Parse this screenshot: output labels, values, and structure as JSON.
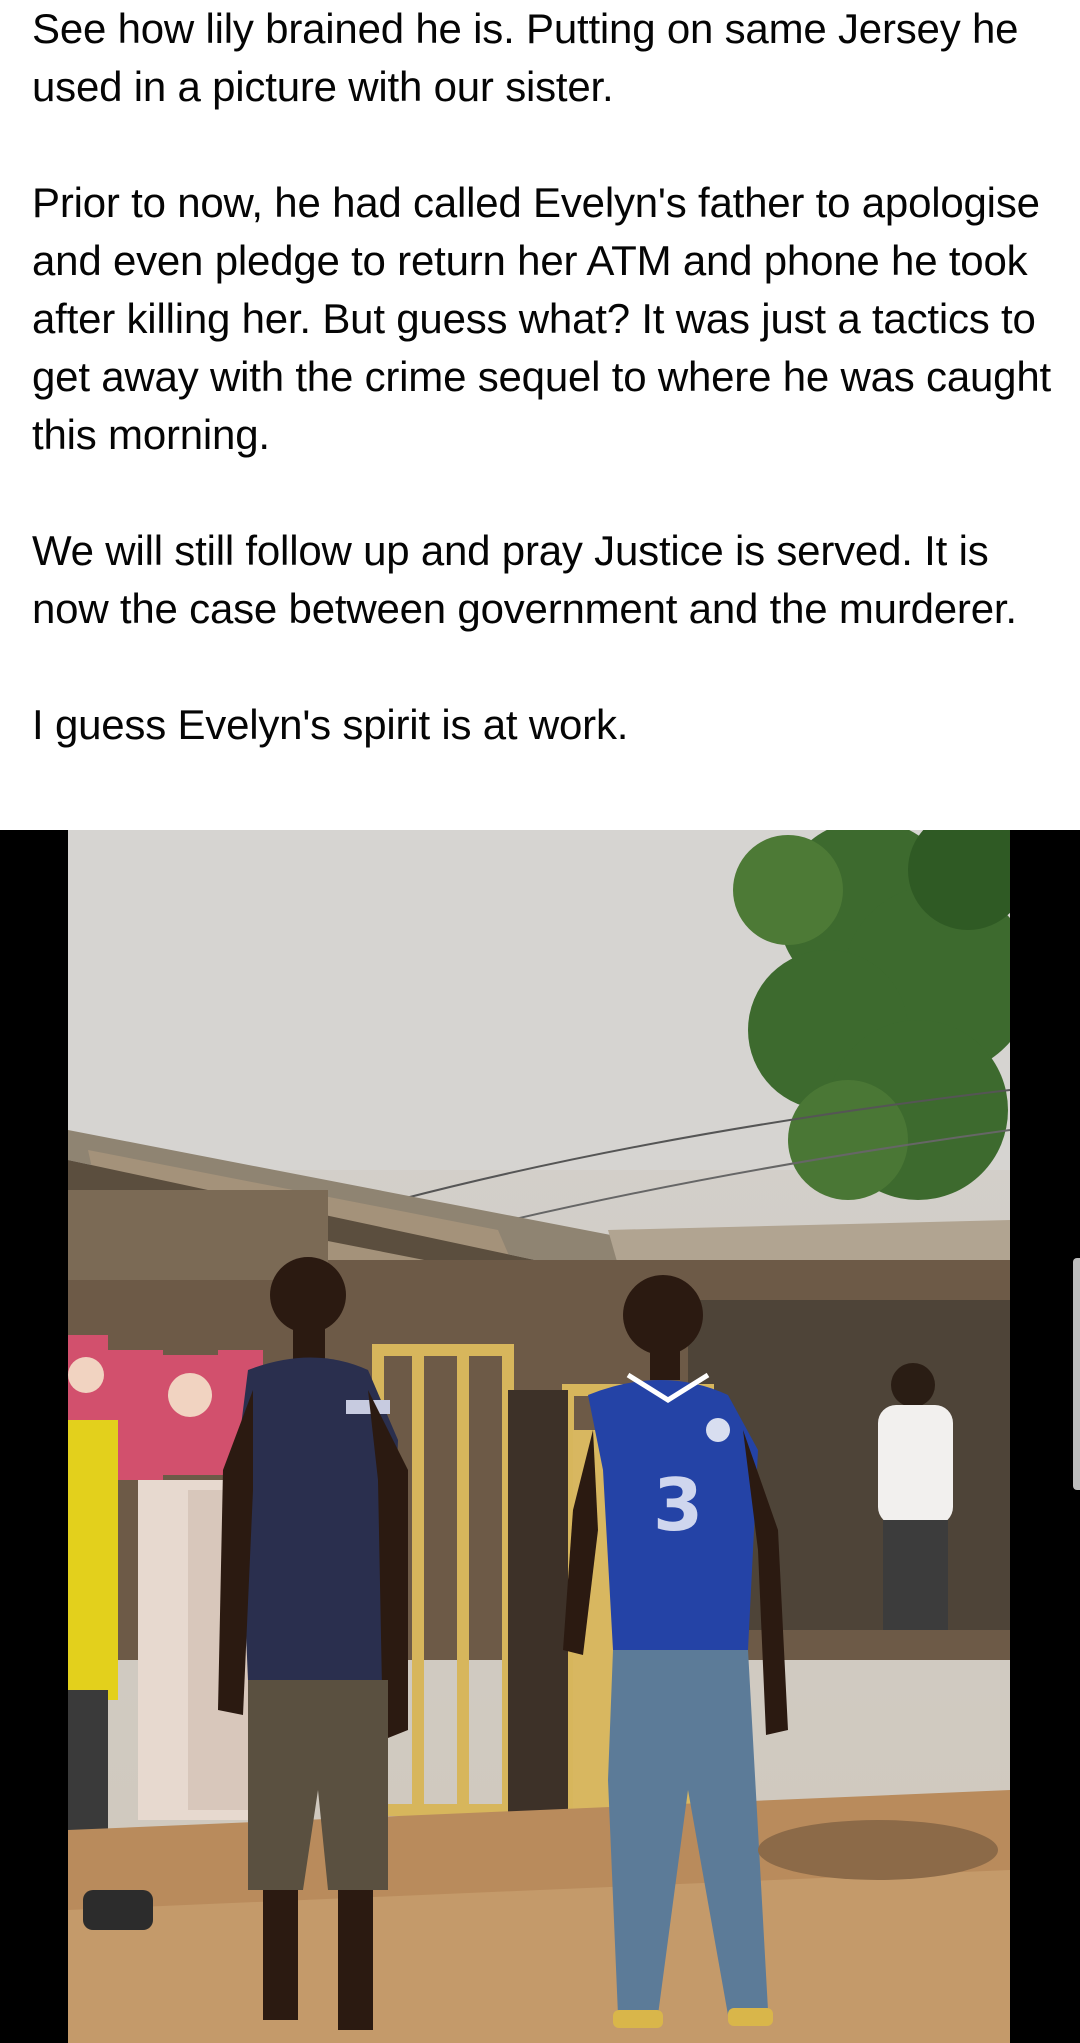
{
  "post": {
    "paragraphs": [
      "See how lily brained he is. Putting on same Jersey he used in a picture with our sister.",
      "Prior to now, he had called Evelyn's father to apologise and even pledge to return her ATM and phone he took after killing her. But guess what? It was just a tactics to get away with the crime sequel to where he was caught this morning.",
      "We will still follow up and pray Justice is served. It is now the case between government and the murderer.",
      "I guess Evelyn's spirit is at work."
    ]
  },
  "photo": {
    "jersey_sponsor_glyph": "3"
  },
  "colors": {
    "text": "#050505",
    "letterbox": "#000000",
    "sky": "#d6d3cf",
    "blue_jersey": "#2443a6",
    "navy_shirt": "#2a2f4e",
    "yellow_frame": "#d7b65c",
    "pink_banner": "#d2506d",
    "ground": "#b98b5c"
  }
}
